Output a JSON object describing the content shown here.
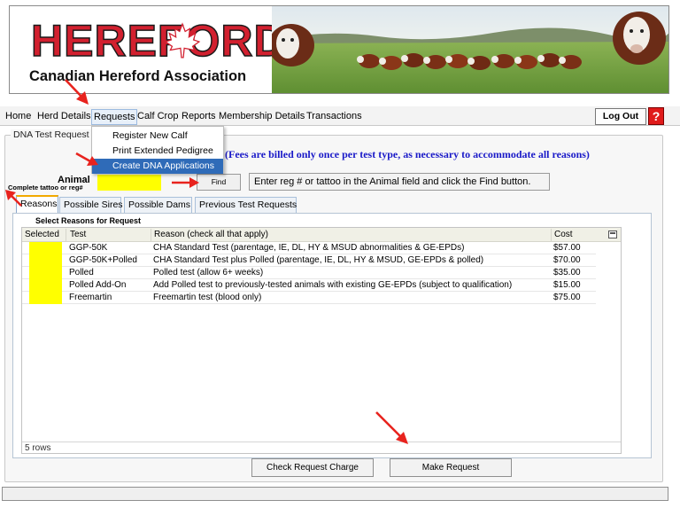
{
  "banner": {
    "logo_word": "HEREFORD",
    "logo_subtitle": "Canadian Hereford Association",
    "photo_alt": "Hereford cattle herd in pasture"
  },
  "nav": {
    "items": [
      "Home",
      "Herd Details",
      "Requests",
      "Calf Crop",
      "Reports",
      "Membership Details",
      "Transactions"
    ],
    "active": "Requests",
    "logout_label": "Log Out",
    "help_label": "?"
  },
  "requests_menu": {
    "items": [
      "Register New Calf",
      "Print Extended Pedigree",
      "Create DNA Applications"
    ],
    "highlighted": "Create DNA Applications"
  },
  "group": {
    "title": "DNA Test Request S",
    "fee_note": "(Fees are billed only once per test type, as necessary to accommodate all reasons)"
  },
  "animal": {
    "label": "Animal",
    "sublabel": "Complete tattoo or reg#",
    "value": "",
    "find_label": "Find",
    "hint": "Enter reg # or tattoo in the Animal field and click the Find button."
  },
  "tabs": [
    "Reasons",
    "Possible Sires",
    "Possible Dams",
    "Previous Test Requests"
  ],
  "active_tab": "Reasons",
  "reasons": {
    "section_title": "Select Reasons for Request",
    "columns": [
      "Selected",
      "Test",
      "Reason (check all that apply)",
      "Cost"
    ],
    "rows": [
      {
        "test": "GGP-50K",
        "reason": "CHA Standard Test (parentage, IE, DL, HY & MSUD abnormalities & GE-EPDs)",
        "cost": "$57.00"
      },
      {
        "test": "GGP-50K+Polled",
        "reason": "CHA Standard Test plus Polled (parentage, IE, DL, HY & MSUD, GE-EPDs & polled)",
        "cost": "$70.00"
      },
      {
        "test": "Polled",
        "reason": "Polled test (allow 6+ weeks)",
        "cost": "$35.00"
      },
      {
        "test": "Polled Add-On",
        "reason": "Add Polled test to previously-tested animals with existing GE-EPDs (subject to qualification)",
        "cost": "$15.00"
      },
      {
        "test": "Freemartin",
        "reason": "Freemartin test (blood only)",
        "cost": "$75.00"
      }
    ],
    "footer": "5 rows"
  },
  "buttons": {
    "check_charge": "Check Request Charge",
    "make_request": "Make Request"
  },
  "colors": {
    "brand_red": "#d2202f",
    "highlight_yellow": "#ffff00",
    "menu_highlight": "#2f6bb8",
    "fee_note_blue": "#1a1ac8",
    "annotation_arrow": "#e8231e"
  }
}
